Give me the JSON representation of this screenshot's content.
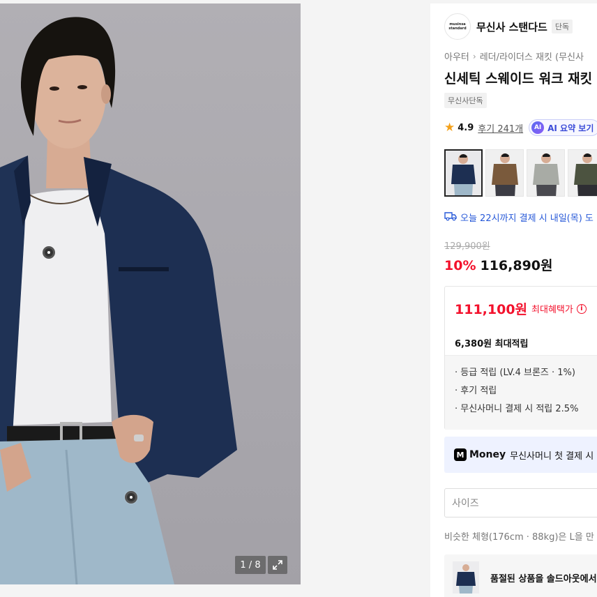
{
  "gallery": {
    "pager": "1 / 8",
    "icons": {
      "hotspot": "tag-dot-icon",
      "expand": "expand-icon"
    }
  },
  "brand": {
    "logo_line1": "musinsa",
    "logo_line2": "standard",
    "name": "무신사 스탠다드",
    "tag": "단독"
  },
  "breadcrumb": {
    "category": "아우터",
    "subcategory": "레더/라이더스 재킷 (무신사"
  },
  "product": {
    "title": "신세틱 스웨이드 워크 재킷",
    "exclusive_badge": "무신사단독"
  },
  "rating": {
    "score": "4.9",
    "reviews_link": "후기 241개",
    "ai_badge": "AI",
    "ai_summary": "AI 요약 보기"
  },
  "delivery": {
    "text": "오늘 22시까지 결제 시 내일(목) 도"
  },
  "pricing": {
    "original": "129,900원",
    "discount": "10%",
    "sale": "116,890원"
  },
  "benefit": {
    "max_price": "111,100원",
    "max_label": "최대혜택가",
    "info_icon": "i",
    "points": "6,380원 최대적립",
    "details": [
      "· 등급 적립 (LV.4 브론즈 · 1%)",
      "· 후기 적립",
      "· 무신사머니 결제 시 적립 2.5%"
    ]
  },
  "money_banner": {
    "logo_mark": "M",
    "logo_text": "Money",
    "text": "무신사머니 첫 결제 시"
  },
  "options": {
    "size_placeholder": "사이즈",
    "fit_note": "비슷한 체형(176cm · 88kg)은 L을 만"
  },
  "soldout": {
    "text": "품절된 상품을 솔드아웃에서"
  },
  "colors": {
    "sale_red": "#f3112c",
    "link_blue": "#2658d8",
    "star": "#f4a11b",
    "jacket_navy": "#1d2f52"
  }
}
